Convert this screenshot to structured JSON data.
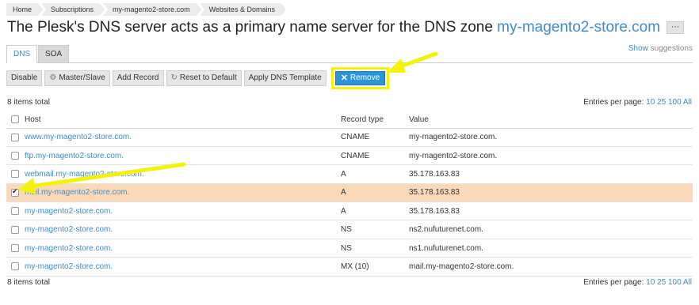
{
  "breadcrumb": [
    "Home",
    "Subscriptions",
    "my-magento2-store.com",
    "Websites & Domains"
  ],
  "title": {
    "prefix": "The Plesk's DNS server acts as a primary name server for the DNS zone ",
    "zone": "my-magento2-store.com",
    "more": "···"
  },
  "tabs": [
    {
      "label": "DNS",
      "active": true
    },
    {
      "label": "SOA",
      "active": false
    }
  ],
  "show_suggestions": {
    "show": "Show",
    "rest": " suggestions"
  },
  "toolbar": {
    "disable": "Disable",
    "master_slave": "Master/Slave",
    "add_record": "Add Record",
    "reset_default": "Reset to Default",
    "apply_template": "Apply DNS Template",
    "remove": "Remove"
  },
  "summary": {
    "total": "8 items total",
    "entries_label": "Entries per page:",
    "entries_options": [
      "10",
      "25",
      "100",
      "All"
    ]
  },
  "table": {
    "headers": {
      "host": "Host",
      "type": "Record type",
      "value": "Value"
    },
    "rows": [
      {
        "host": "www.my-magento2-store.com.",
        "type": "CNAME",
        "value": "my-magento2-store.com.",
        "selected": false
      },
      {
        "host": "ftp.my-magento2-store.com.",
        "type": "CNAME",
        "value": "my-magento2-store.com.",
        "selected": false
      },
      {
        "host": "webmail.my-magento2-store.com.",
        "type": "A",
        "value": "35.178.163.83",
        "selected": false
      },
      {
        "host": "mail.my-magento2-store.com.",
        "type": "A",
        "value": "35.178.163.83",
        "selected": true
      },
      {
        "host": "my-magento2-store.com.",
        "type": "A",
        "value": "35.178.163.83",
        "selected": false
      },
      {
        "host": "my-magento2-store.com.",
        "type": "NS",
        "value": "ns2.nufuturenet.com.",
        "selected": false
      },
      {
        "host": "my-magento2-store.com.",
        "type": "NS",
        "value": "ns1.nufuturenet.com.",
        "selected": false
      },
      {
        "host": "my-magento2-store.com.",
        "type": "MX (10)",
        "value": "mail.my-magento2-store.com.",
        "selected": false
      }
    ]
  },
  "colors": {
    "link": "#3c8dc8",
    "selected_row": "#fbd9b8",
    "highlight": "#f4f20d",
    "remove_button": "#2b95d8"
  }
}
